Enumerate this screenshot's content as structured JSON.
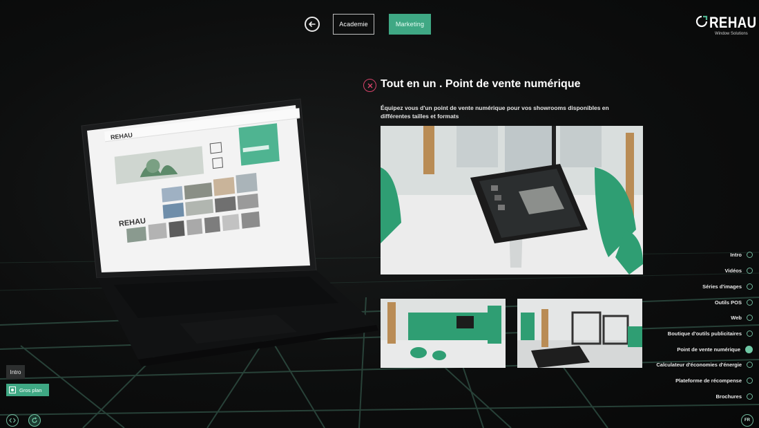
{
  "header": {
    "back_icon": "arrow-left-circle-icon",
    "tabs": [
      {
        "label": "Academie",
        "active": false
      },
      {
        "label": "Marketing",
        "active": true
      }
    ]
  },
  "logo": {
    "word": "REHAU",
    "subtitle": "Window Solutions"
  },
  "panel": {
    "close_icon": "close-circle-icon",
    "title": "Tout en un . Point de vente numérique",
    "description": "Équipez vous d'un point de vente numérique pour vos showrooms disponibles en différentes tailles et formats"
  },
  "side_nav": {
    "items": [
      {
        "label": "Intro",
        "active": false
      },
      {
        "label": "Vidéos",
        "active": false
      },
      {
        "label": "Séries d'images",
        "active": false
      },
      {
        "label": "Outils POS",
        "active": false
      },
      {
        "label": "Web",
        "active": false
      },
      {
        "label": "Boutique d'outils publicitaires",
        "active": false
      },
      {
        "label": "Point de vente numérique",
        "active": true
      },
      {
        "label": "Calculateur d'économies d'énergie",
        "active": false
      },
      {
        "label": "Plateforme de récompense",
        "active": false
      },
      {
        "label": "Brochures",
        "active": false
      }
    ]
  },
  "bottom_left": {
    "intro_label": "Intro",
    "gros_plan_label": "Gros plan",
    "code_icon": "code-brackets-icon",
    "reset_icon": "reset-view-icon"
  },
  "bottom_right": {
    "lang_label": "FR"
  },
  "laptop_screen": {
    "brand": "REHAU"
  },
  "colors": {
    "accent": "#3fa884",
    "accent_light": "#6fc7a4",
    "close": "#d7436a",
    "background": "#0b0c0c"
  }
}
